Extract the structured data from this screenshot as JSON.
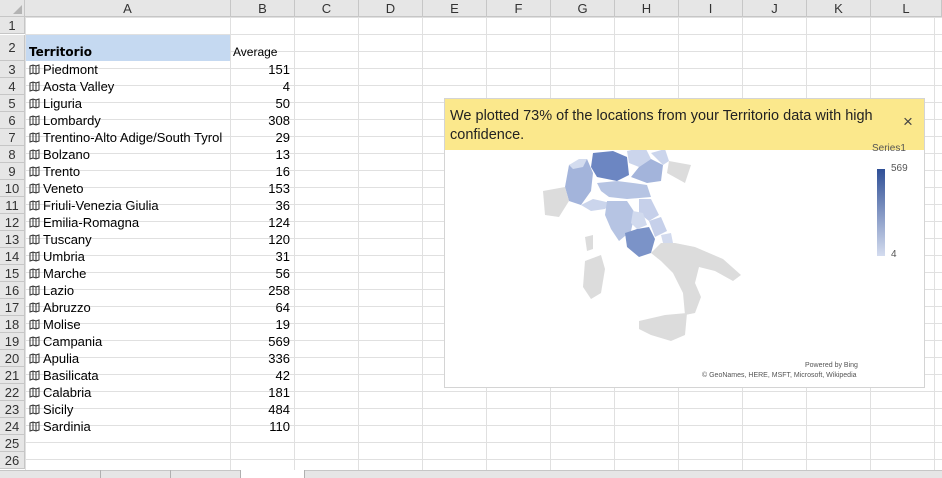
{
  "columns": [
    "A",
    "B",
    "C",
    "D",
    "E",
    "F",
    "G",
    "H",
    "I",
    "J",
    "K",
    "L"
  ],
  "row_numbers": [
    "1",
    "2",
    "3",
    "4",
    "5",
    "6",
    "7",
    "8",
    "9",
    "10",
    "11",
    "12",
    "13",
    "14",
    "15",
    "16",
    "17",
    "18",
    "19",
    "20",
    "21",
    "22",
    "23",
    "24",
    "25",
    "26"
  ],
  "table": {
    "header_territorio": "Territorio",
    "header_average": "Average",
    "rows": [
      {
        "name": "Piedmont",
        "value": "151"
      },
      {
        "name": "Aosta Valley",
        "value": "4"
      },
      {
        "name": "Liguria",
        "value": "50"
      },
      {
        "name": "Lombardy",
        "value": "308"
      },
      {
        "name": "Trentino-Alto Adige/South Tyrol",
        "value": "29"
      },
      {
        "name": "Bolzano",
        "value": "13"
      },
      {
        "name": "Trento",
        "value": "16"
      },
      {
        "name": "Veneto",
        "value": "153"
      },
      {
        "name": "Friuli-Venezia Giulia",
        "value": "36"
      },
      {
        "name": "Emilia-Romagna",
        "value": "124"
      },
      {
        "name": "Tuscany",
        "value": "120"
      },
      {
        "name": "Umbria",
        "value": "31"
      },
      {
        "name": "Marche",
        "value": "56"
      },
      {
        "name": "Lazio",
        "value": "258"
      },
      {
        "name": "Abruzzo",
        "value": "64"
      },
      {
        "name": "Molise",
        "value": "19"
      },
      {
        "name": "Campania",
        "value": "569"
      },
      {
        "name": "Apulia",
        "value": "336"
      },
      {
        "name": "Basilicata",
        "value": "42"
      },
      {
        "name": "Calabria",
        "value": "181"
      },
      {
        "name": "Sicily",
        "value": "484"
      },
      {
        "name": "Sardinia",
        "value": "110"
      }
    ]
  },
  "chart": {
    "banner_text": "We plotted 73% of the locations from your Territorio data with high confidence.",
    "close_glyph": "×",
    "legend_title": "Series1",
    "legend_max": "569",
    "legend_min": "4",
    "credit_line1": "Powered by Bing",
    "credit_line2": "© GeoNames, HERE, MSFT, Microsoft, Wikipedia",
    "colors": {
      "high": "#2f4f96",
      "low": "#d4dcef",
      "unmapped": "#dcdcdc",
      "banner": "#fbe88c"
    }
  },
  "icons": {
    "row_icon": "map-icon",
    "close": "close-icon"
  }
}
